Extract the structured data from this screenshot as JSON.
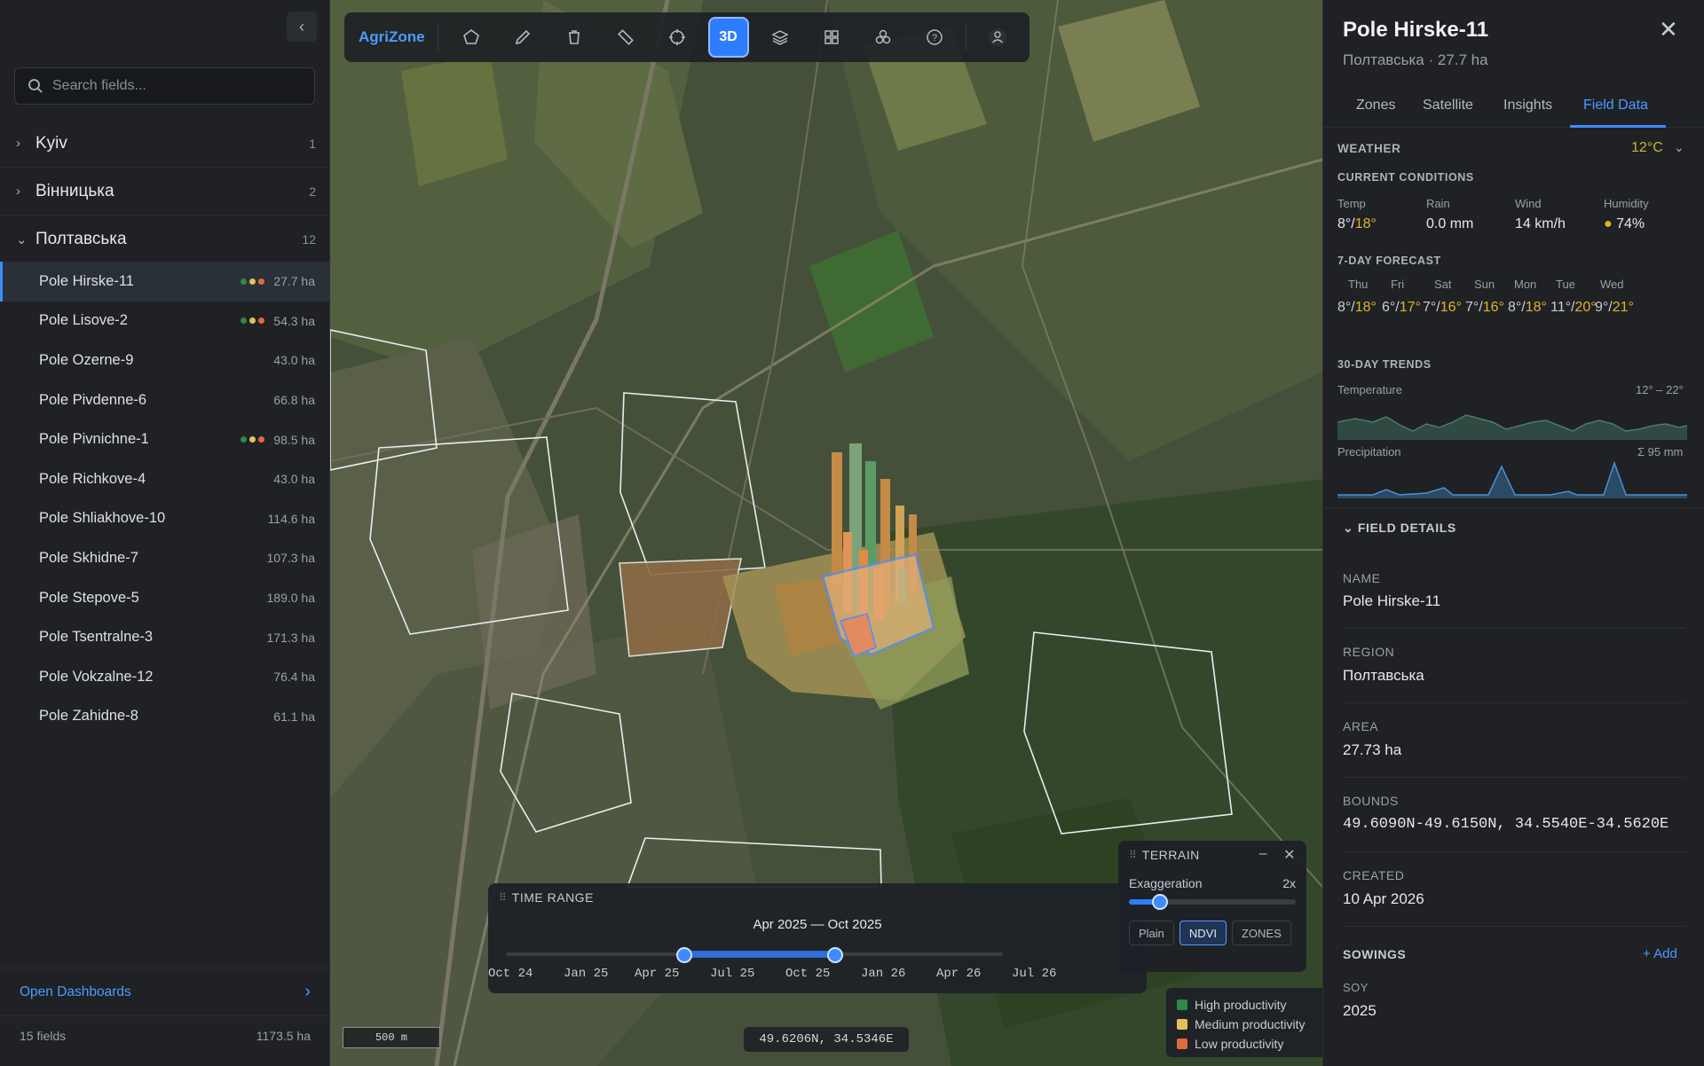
{
  "sidebar": {
    "search_placeholder": "Search fields...",
    "groups": [
      {
        "name": "Kyiv",
        "count": "1"
      },
      {
        "name": "Вінницька",
        "count": "2"
      },
      {
        "name": "Полтавська",
        "count": "12"
      }
    ],
    "fields": [
      {
        "name": "Pole Hirske-11",
        "area": "27.7 ha",
        "dots": true
      },
      {
        "name": "Pole Lisove-2",
        "area": "54.3 ha",
        "dots": true
      },
      {
        "name": "Pole Ozerne-9",
        "area": "43.0 ha",
        "dots": false
      },
      {
        "name": "Pole Pivdenne-6",
        "area": "66.8 ha",
        "dots": false
      },
      {
        "name": "Pole Pivnichne-1",
        "area": "98.5 ha",
        "dots": true
      },
      {
        "name": "Pole Richkove-4",
        "area": "43.0 ha",
        "dots": false
      },
      {
        "name": "Pole Shliakhove-10",
        "area": "114.6 ha",
        "dots": false
      },
      {
        "name": "Pole Skhidne-7",
        "area": "107.3 ha",
        "dots": false
      },
      {
        "name": "Pole Stepove-5",
        "area": "189.0 ha",
        "dots": false
      },
      {
        "name": "Pole Tsentralne-3",
        "area": "171.3 ha",
        "dots": false
      },
      {
        "name": "Pole Vokzalne-12",
        "area": "76.4 ha",
        "dots": false
      },
      {
        "name": "Pole Zahidne-8",
        "area": "61.1 ha",
        "dots": false
      }
    ],
    "open_dashboards": "Open Dashboards",
    "footer_count": "15 fields",
    "footer_area": "1173.5 ha"
  },
  "toolbar": {
    "brand": "AgriZone",
    "mode_3d": "3D",
    "icons": [
      "polygon-icon",
      "pencil-icon",
      "trash-icon",
      "ruler-icon",
      "crosshair-icon",
      "3d-button",
      "layers-icon",
      "grid-icon",
      "cluster-icon",
      "help-icon",
      "user-icon"
    ]
  },
  "map": {
    "scale": "500 m",
    "coords": "49.6206N, 34.5346E"
  },
  "time_range": {
    "title": "TIME RANGE",
    "label": "Apr 2025 — Oct 2025",
    "ticks": [
      "Oct 24",
      "Jan 25",
      "Apr 25",
      "Jul 25",
      "Oct 25",
      "Jan 26",
      "Apr 26",
      "Jul 26"
    ]
  },
  "terrain": {
    "title": "TERRAIN",
    "exaggeration_label": "Exaggeration",
    "exaggeration_value": "2x",
    "modes": [
      "Plain",
      "NDVI",
      "ZONES"
    ],
    "active_mode": "NDVI"
  },
  "legend": [
    {
      "label": "High productivity",
      "color": "#2f8a4a"
    },
    {
      "label": "Medium productivity",
      "color": "#e3c05a"
    },
    {
      "label": "Low productivity",
      "color": "#e06a3e"
    }
  ],
  "panel": {
    "title": "Pole Hirske-11",
    "subtitle": "Полтавська · 27.7 ha",
    "tabs": [
      "Zones",
      "Satellite",
      "Insights",
      "Field Data"
    ],
    "active_tab": "Field Data",
    "weather": {
      "heading": "WEATHER",
      "temp": "12°C",
      "current_heading": "CURRENT CONDITIONS",
      "current": [
        {
          "label": "Temp",
          "low": "8°",
          "high": "18°"
        },
        {
          "label": "Rain",
          "value": "0.0 mm"
        },
        {
          "label": "Wind",
          "value": "14 km/h"
        },
        {
          "label": "Humidity",
          "value": "74%"
        }
      ],
      "forecast_heading": "7-DAY FORECAST",
      "forecast": [
        {
          "day": "Thu",
          "low": "8°",
          "high": "18°"
        },
        {
          "day": "Fri",
          "low": "6°",
          "high": "17°"
        },
        {
          "day": "Sat",
          "low": "7°",
          "high": "16°"
        },
        {
          "day": "Sun",
          "low": "7°",
          "high": "16°"
        },
        {
          "day": "Mon",
          "low": "8°",
          "high": "18°"
        },
        {
          "day": "Tue",
          "low": "11°",
          "high": "20°"
        },
        {
          "day": "Wed",
          "low": "9°",
          "high": "21°"
        }
      ],
      "trends_heading": "30-DAY TRENDS",
      "temperature_label": "Temperature",
      "temperature_range": "12° – 22°",
      "precipitation_label": "Precipitation",
      "precipitation_total": "Σ 95 mm"
    },
    "details": {
      "heading": "FIELD DETAILS",
      "name_label": "NAME",
      "name": "Pole Hirske-11",
      "region_label": "REGION",
      "region": "Полтавська",
      "area_label": "AREA",
      "area": "27.73 ha",
      "bounds_label": "BOUNDS",
      "bounds": "49.6090N-49.6150N, 34.5540E-34.5620E",
      "created_label": "CREATED",
      "created": "10 Apr 2026",
      "sowings_label": "SOWINGS",
      "add": "+ Add",
      "crop": "SOY",
      "year": "2025"
    }
  }
}
